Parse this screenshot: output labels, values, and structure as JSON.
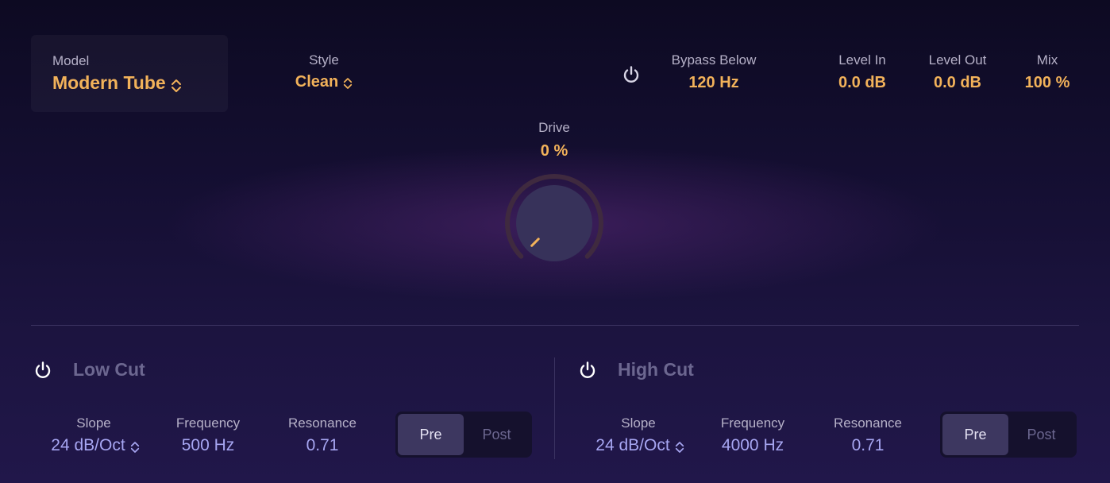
{
  "header": {
    "model": {
      "label": "Model",
      "value": "Modern Tube"
    },
    "style": {
      "label": "Style",
      "value": "Clean"
    },
    "bypass": {
      "label": "Bypass Below",
      "value": "120 Hz"
    },
    "level_in": {
      "label": "Level In",
      "value": "0.0 dB"
    },
    "level_out": {
      "label": "Level Out",
      "value": "0.0 dB"
    },
    "mix": {
      "label": "Mix",
      "value": "100 %"
    }
  },
  "drive": {
    "label": "Drive",
    "value": "0 %",
    "level_percent": 0
  },
  "low_cut": {
    "title": "Low Cut",
    "slope": {
      "label": "Slope",
      "value": "24 dB/Oct"
    },
    "frequency": {
      "label": "Frequency",
      "value": "500 Hz"
    },
    "resonance": {
      "label": "Resonance",
      "value": "0.71"
    },
    "pre_label": "Pre",
    "post_label": "Post",
    "selected": "Pre"
  },
  "high_cut": {
    "title": "High Cut",
    "slope": {
      "label": "Slope",
      "value": "24 dB/Oct"
    },
    "frequency": {
      "label": "Frequency",
      "value": "4000 Hz"
    },
    "resonance": {
      "label": "Resonance",
      "value": "0.71"
    },
    "pre_label": "Pre",
    "post_label": "Post",
    "selected": "Pre"
  },
  "colors": {
    "accent": "#f2b25a",
    "value_blue": "#a7a6f2",
    "line": "#e88a2e"
  }
}
